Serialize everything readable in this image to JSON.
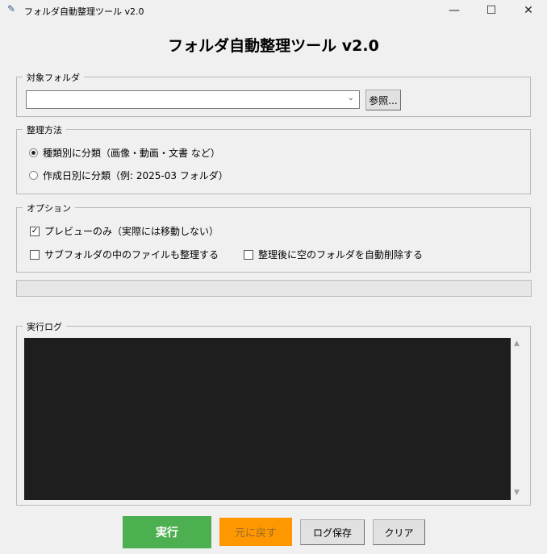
{
  "window": {
    "title": "フォルダ自動整理ツール v2.0",
    "minimize": "—",
    "maximize": "☐",
    "close": "✕"
  },
  "heading": "フォルダ自動整理ツール v2.0",
  "target": {
    "label": "対象フォルダ",
    "value": "",
    "browse": "参照..."
  },
  "method": {
    "label": "整理方法",
    "options": [
      {
        "label": "種類別に分類（画像・動画・文書 など）",
        "selected": true
      },
      {
        "label": "作成日別に分類（例: 2025-03 フォルダ）",
        "selected": false
      }
    ]
  },
  "options": {
    "label": "オプション",
    "items": [
      {
        "label": "プレビューのみ（実際には移動しない）",
        "checked": true
      },
      {
        "label": "サブフォルダの中のファイルも整理する",
        "checked": false
      },
      {
        "label": "整理後に空のフォルダを自動削除する",
        "checked": false
      }
    ]
  },
  "progress": {
    "value": 0
  },
  "log": {
    "label": "実行ログ",
    "text": ""
  },
  "buttons": {
    "run": "実行",
    "undo": "元に戻す",
    "save_log": "ログ保存",
    "clear": "クリア"
  },
  "colors": {
    "run": "#4caf50",
    "undo": "#ff9800"
  }
}
